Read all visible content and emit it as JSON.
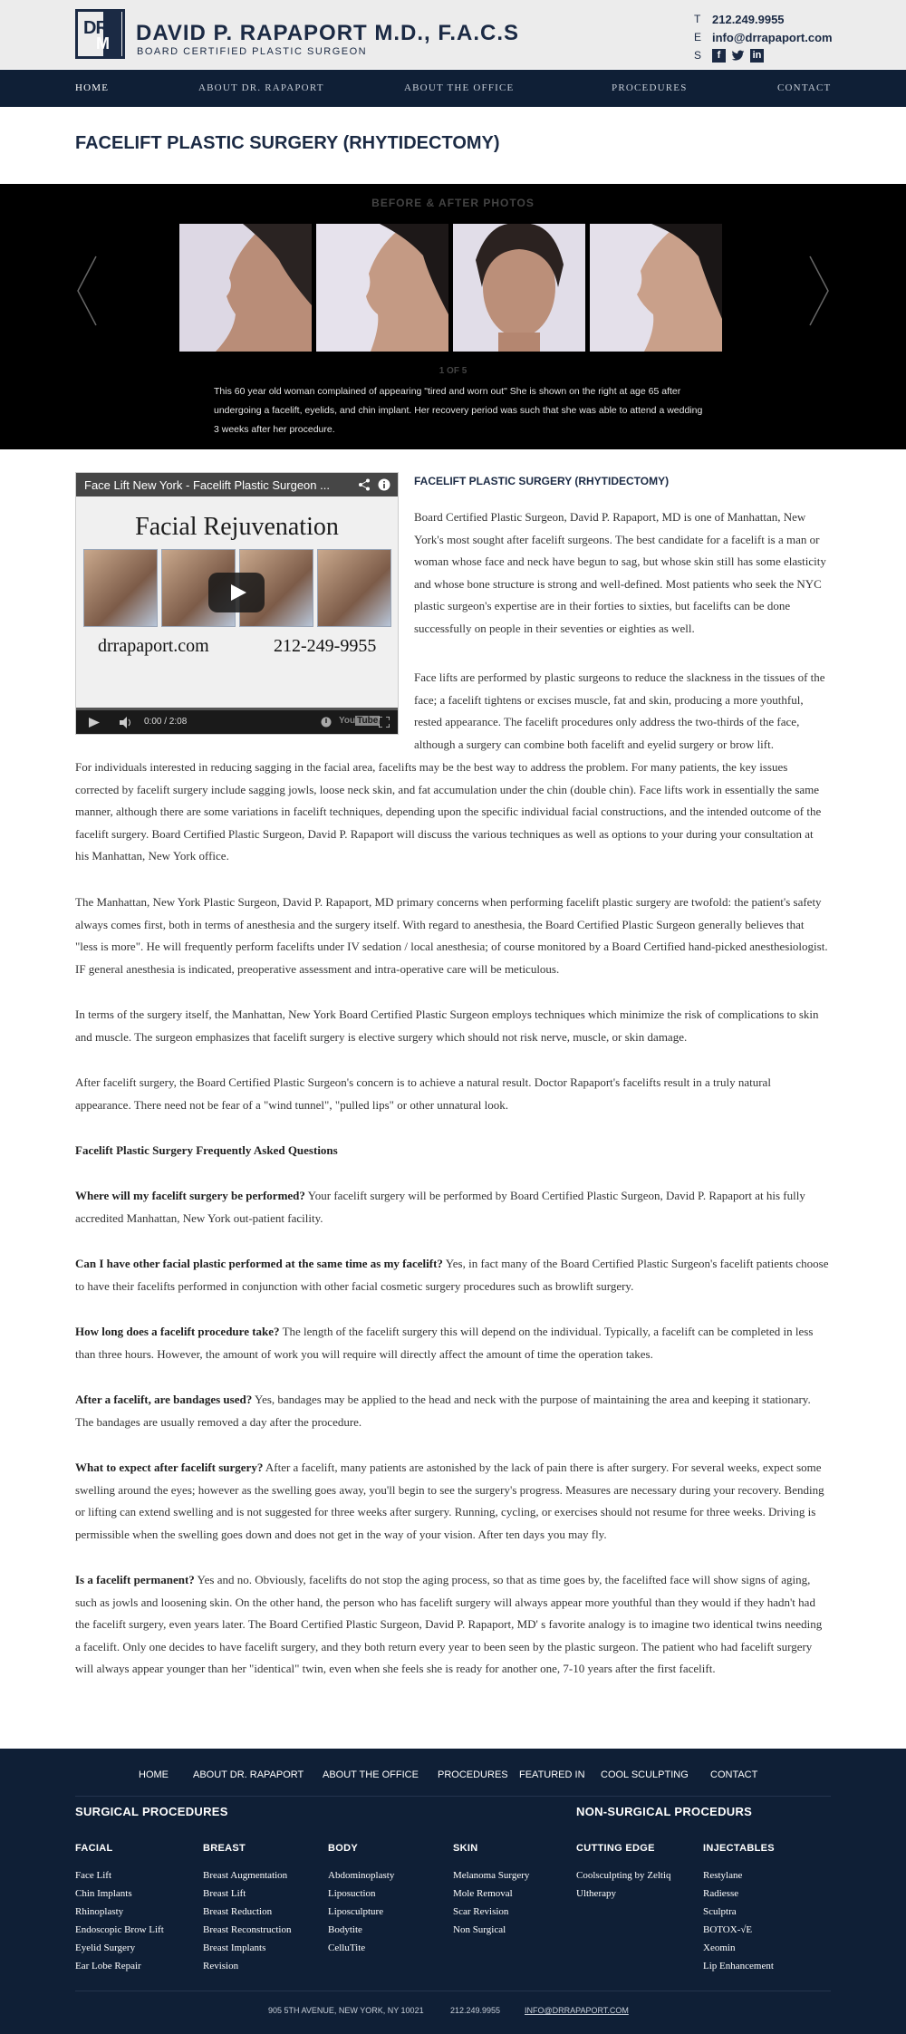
{
  "header": {
    "logo_letters_1": "DR",
    "logo_letters_2": "M",
    "name": "DAVID P. RAPAPORT M.D., F.A.C.S",
    "subtitle": "BOARD CERTIFIED PLASTIC SURGEON",
    "phone_key": "T",
    "phone": "212.249.9955",
    "email_key": "E",
    "email": "info@drrapaport.com",
    "social_key": "S",
    "social": [
      "facebook-icon",
      "twitter-icon",
      "linkedin-icon"
    ]
  },
  "nav": {
    "items": [
      "HOME",
      "ABOUT DR. RAPAPORT",
      "ABOUT THE OFFICE",
      "PROCEDURES",
      "CONTACT"
    ]
  },
  "page": {
    "title": "FACELIFT PLASTIC SURGERY (RHYTIDECTOMY)"
  },
  "slider": {
    "label": "BEFORE & AFTER PHOTOS",
    "counter": "1 OF 5",
    "caption": "This 60 year old woman complained of appearing \"tired and worn out\" She is shown on the right at age 65 after undergoing a facelift, eyelids, and chin implant. Her recovery period was such that she was able to attend a wedding 3 weeks after her procedure."
  },
  "video": {
    "title": "Face Lift New York  - Facelift Plastic Surgeon ...",
    "banner": "Facial  Rejuvenation",
    "web": "drrapaport.com",
    "phone": "212-249-9955",
    "time": "0:00 / 2:08"
  },
  "article": {
    "heading": "FACELIFT PLASTIC SURGERY (RHYTIDECTOMY)",
    "p1": "Board Certified Plastic Surgeon, David P. Rapaport, MD is one of Manhattan, New York's most sought after facelift surgeons.  The best candidate for a facelift is a man or woman whose face and neck have begun to sag, but whose skin still has some elasticity and whose bone structure is strong and well-defined. Most patients who seek the NYC plastic surgeon's expertise are in their forties to sixties, but facelifts can be done successfully on people in their seventies or eighties as well.",
    "p2": "Face lifts are performed by plastic surgeons to reduce the slackness in the tissues of the face; a facelift tightens or excises muscle, fat and skin, producing a more youthful, rested appearance.  The facelift procedures only address the two-thirds of the face, although a surgery can combine both facelift and eyelid surgery or brow lift.",
    "p3": "For individuals interested in reducing sagging in the facial area, facelifts may be the best way to address the problem. For many patients, the key issues corrected by facelift surgery include sagging jowls, loose neck skin, and fat accumulation under the chin (double chin). Face lifts work in essentially the same manner, although there are some variations in facelift techniques, depending upon the specific individual facial constructions, and the intended outcome of the facelift surgery.  Board Certified Plastic Surgeon, David P. Rapaport will discuss the various techniques as well as options to your during your consultation at his Manhattan, New York office.",
    "p4": "The Manhattan, New York Plastic Surgeon, David P. Rapaport, MD primary concerns when performing facelift plastic surgery are twofold:  the patient's safety always comes first, both in terms of anesthesia and the surgery itself.  With regard to anesthesia, the Board Certified Plastic Surgeon generally believes that \"less is more\".  He will frequently perform facelifts under IV sedation / local anesthesia; of course monitored by a Board Certified hand-picked anesthesiologist.  IF general anesthesia is indicated, preoperative assessment and intra-operative care will be meticulous.",
    "p5": "In terms of the surgery itself, the Manhattan, New York Board Certified Plastic Surgeon employs techniques which minimize the risk of complications to skin and muscle.  The surgeon emphasizes that facelift surgery is elective surgery which should not risk nerve, muscle, or skin damage.",
    "p6": "After facelift surgery, the Board Certified Plastic Surgeon's concern is to achieve a natural result.  Doctor Rapaport's facelifts result in a truly natural appearance.  There need not be fear of a \"wind tunnel\", \"pulled lips\" or other unnatural look.",
    "faq_heading": "Facelift Plastic Surgery Frequently Asked Questions",
    "faq": [
      {
        "q": "Where will my facelift surgery be performed?",
        "a": "  Your facelift surgery will be performed by Board Certified Plastic Surgeon, David P. Rapaport at his fully accredited Manhattan, New York out-patient facility."
      },
      {
        "q": "Can I have other facial plastic performed at the same time as my facelift?",
        "a": " Yes, in fact many of the Board Certified Plastic Surgeon's  facelift patients choose to have their facelifts performed in conjunction with other facial cosmetic surgery procedures such as browlift surgery."
      },
      {
        "q": "How long does a facelift procedure take?",
        "a": " The length of the facelift surgery this will depend on the individual. Typically, a facelift can be completed in less than three hours. However, the amount of work you will require will directly affect the amount of time the operation takes."
      },
      {
        "q": "After a facelift, are bandages used?",
        "a": "  Yes, bandages may be applied to the head and neck with the purpose of maintaining the area and keeping it stationary. The bandages are usually removed a day after the procedure."
      },
      {
        "q": "What to expect after facelift surgery?",
        "a": " After a facelift, many patients are astonished by the lack of  pain there is after surgery. For several weeks, expect some swelling around the eyes; however as the swelling goes away, you'll begin to see the surgery's progress. Measures are necessary during your recovery. Bending or lifting can extend swelling and is not suggested for three weeks after surgery. Running, cycling, or exercises should not resume for three weeks. Driving is permissible when the swelling goes down and does not get in the way of your vision. After ten days you may fly."
      },
      {
        "q": "Is a facelift permanent?",
        "a": " Yes and no. Obviously, facelifts do not stop the aging process, so that as time goes by, the facelifted face will show signs of aging, such as jowls and loosening skin.  On the other hand, the person who has facelift surgery will always appear more youthful than they would if they hadn't had the facelift surgery, even years later.  The Board Certified Plastic Surgeon, David P. Rapaport, MD' s favorite analogy is to imagine two identical twins needing a facelift.  Only one decides to have facelift surgery, and they both return every year to been seen by the plastic surgeon.  The patient who had facelift surgery will always appear younger than her \"identical\" twin, even when she feels she is ready for another one, 7-10 years after the first facelift."
      }
    ]
  },
  "footer": {
    "nav": [
      "HOME",
      "ABOUT DR. RAPAPORT",
      "ABOUT THE OFFICE",
      "PROCEDURES",
      "FEATURED IN",
      "COOL SCULPTING",
      "CONTACT"
    ],
    "surgical_heading": "SURGICAL PROCEDURES",
    "nonsurgical_heading": "NON-SURGICAL PROCEDURS",
    "columns": [
      {
        "heading": "FACIAL",
        "items": [
          "Face Lift",
          "Chin Implants",
          "Rhinoplasty",
          "Endoscopic Brow Lift",
          "Eyelid Surgery",
          "Ear Lobe Repair"
        ]
      },
      {
        "heading": "BREAST",
        "items": [
          "Breast Augmentation",
          "Breast Lift",
          "Breast Reduction",
          "Breast Reconstruction",
          "Breast Implants",
          "Revision"
        ]
      },
      {
        "heading": "BODY",
        "items": [
          "Abdominoplasty",
          "Liposuction",
          "Liposculpture",
          "Bodytite",
          "CelluTite"
        ]
      },
      {
        "heading": "SKIN",
        "items": [
          "Melanoma Surgery",
          "Mole Removal",
          "Scar Revision",
          "Non Surgical"
        ]
      },
      {
        "heading": "CUTTING EDGE",
        "items": [
          "Coolsculpting by Zeltiq",
          "Ultherapy"
        ]
      },
      {
        "heading": "INJECTABLES",
        "items": [
          "Restylane",
          "Radiesse",
          "Sculptra",
          "BOTOX-√E",
          "Xeomin",
          "Lip Enhancement"
        ]
      }
    ],
    "address": "905 5TH AVENUE, NEW YORK, NY 10021",
    "phone": "212.249.9955",
    "email": "INFO@DRRAPAPORT.COM"
  },
  "colors": {
    "navy": "#0f1f36",
    "brand_text": "#1b2a44",
    "header_bg": "#ececec"
  }
}
